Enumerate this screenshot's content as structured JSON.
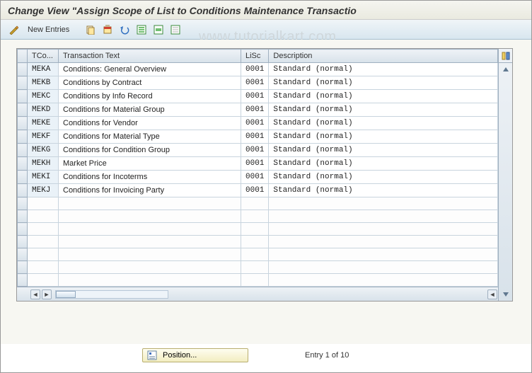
{
  "title": "Change View \"Assign Scope of List to Conditions Maintenance Transactio",
  "watermark": "www.tutorialkart.com",
  "toolbar": {
    "new_entries": "New Entries"
  },
  "columns": {
    "row_selector": "",
    "tcode": "TCo...",
    "text": "Transaction Text",
    "lisc": "LiSc",
    "desc": "Description"
  },
  "rows": [
    {
      "tcode": "MEKA",
      "text": "Conditions: General Overview",
      "lisc": "0001",
      "desc": "Standard (normal)"
    },
    {
      "tcode": "MEKB",
      "text": "Conditions by Contract",
      "lisc": "0001",
      "desc": "Standard (normal)"
    },
    {
      "tcode": "MEKC",
      "text": "Conditions by Info Record",
      "lisc": "0001",
      "desc": "Standard (normal)"
    },
    {
      "tcode": "MEKD",
      "text": "Conditions for Material Group",
      "lisc": "0001",
      "desc": "Standard (normal)"
    },
    {
      "tcode": "MEKE",
      "text": "Conditions for Vendor",
      "lisc": "0001",
      "desc": "Standard (normal)"
    },
    {
      "tcode": "MEKF",
      "text": "Conditions for Material Type",
      "lisc": "0001",
      "desc": "Standard (normal)"
    },
    {
      "tcode": "MEKG",
      "text": "Conditions for Condition Group",
      "lisc": "0001",
      "desc": "Standard (normal)"
    },
    {
      "tcode": "MEKH",
      "text": "Market Price",
      "lisc": "0001",
      "desc": "Standard (normal)"
    },
    {
      "tcode": "MEKI",
      "text": "Conditions for Incoterms",
      "lisc": "0001",
      "desc": "Standard (normal)"
    },
    {
      "tcode": "MEKJ",
      "text": "Conditions for Invoicing Party",
      "lisc": "0001",
      "desc": "Standard (normal)"
    }
  ],
  "empty_rows": 7,
  "footer": {
    "position_button": "Position...",
    "entry_text": "Entry 1 of 10"
  }
}
